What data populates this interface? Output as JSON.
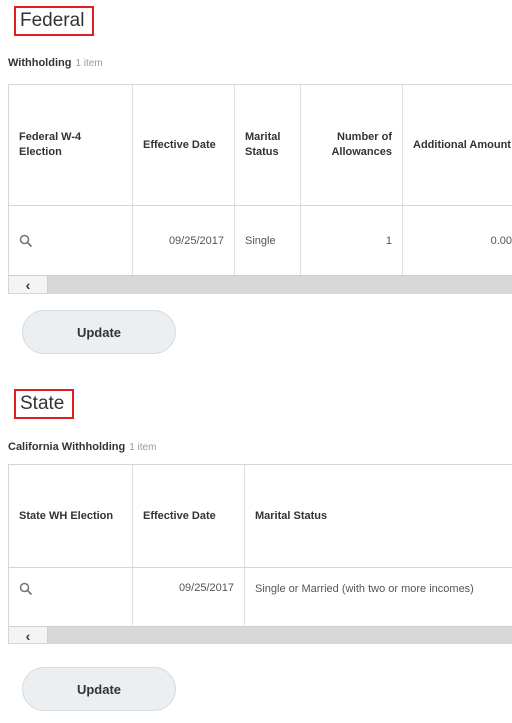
{
  "federal": {
    "title": "Federal",
    "withholding_label": "Withholding",
    "item_count": "1 item",
    "columns": [
      "Federal W-4 Election",
      "Effective Date",
      "Marital Status",
      "Number of Allowances",
      "Additional Amount"
    ],
    "row": {
      "election_icon": "search-icon",
      "effective_date": "09/25/2017",
      "marital_status": "Single",
      "allowances": "1",
      "additional_amount": "0.00"
    },
    "update_label": "Update"
  },
  "state": {
    "title": "State",
    "withholding_label": "California Withholding",
    "item_count": "1 item",
    "columns": [
      "State WH Election",
      "Effective Date",
      "Marital Status"
    ],
    "row": {
      "election_icon": "search-icon",
      "effective_date": "09/25/2017",
      "marital_status": "Single or Married (with two or more incomes)"
    },
    "update_label": "Update"
  },
  "colors": {
    "highlight_border": "#e02020",
    "button_bg": "#eceff1",
    "scroll_track": "#d8d8d8"
  }
}
